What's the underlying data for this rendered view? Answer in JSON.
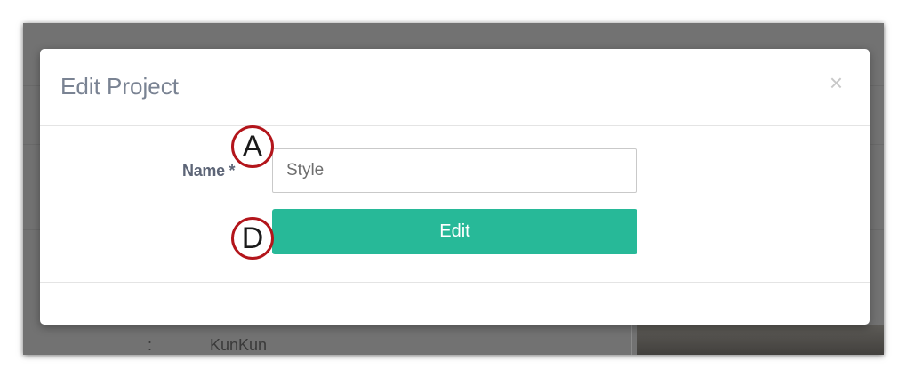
{
  "modal": {
    "title": "Edit Project",
    "close_glyph": "×",
    "name_label": "Name *",
    "name_value": "Style",
    "edit_label": "Edit"
  },
  "annotations": {
    "a": "A",
    "d": "D"
  },
  "background": {
    "visible_text": "KunKun",
    "separator": ":"
  },
  "colors": {
    "accent": "#27b998",
    "overlay": "#727272",
    "annotation_ring": "#b3151b"
  },
  "icons": {
    "close": "close-icon"
  }
}
